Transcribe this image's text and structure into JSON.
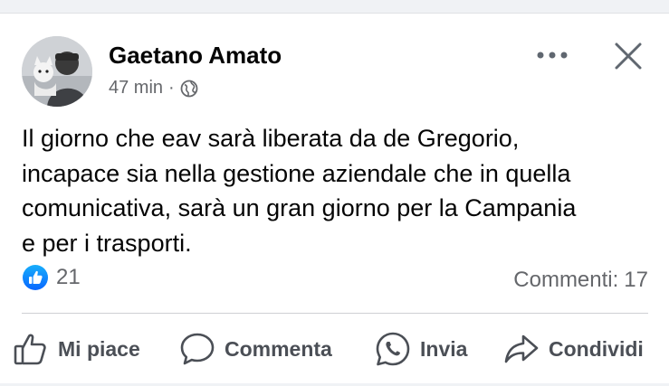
{
  "post": {
    "author": "Gaetano Amato",
    "time": "47 min",
    "separator": "·",
    "privacy_icon": "globe-icon",
    "text": "Il giorno che eav sarà liberata da de Gregorio,\nincapace sia nella gestione aziendale che in quella\ncomunicativa, sarà un gran giorno per la Campania\ne per i trasporti."
  },
  "stats": {
    "reaction_icon": "like-reaction-icon",
    "reaction_count": "21",
    "comments_label": "Commenti:",
    "comments_count": "17"
  },
  "actions": {
    "like": "Mi piace",
    "comment": "Commenta",
    "share_whatsapp": "Invia",
    "share": "Condividi"
  },
  "colors": {
    "text_primary": "#050505",
    "text_secondary": "#65676b",
    "action_text": "#4b4f56",
    "like_blue": "#1877f2",
    "divider": "#ced0d4"
  }
}
